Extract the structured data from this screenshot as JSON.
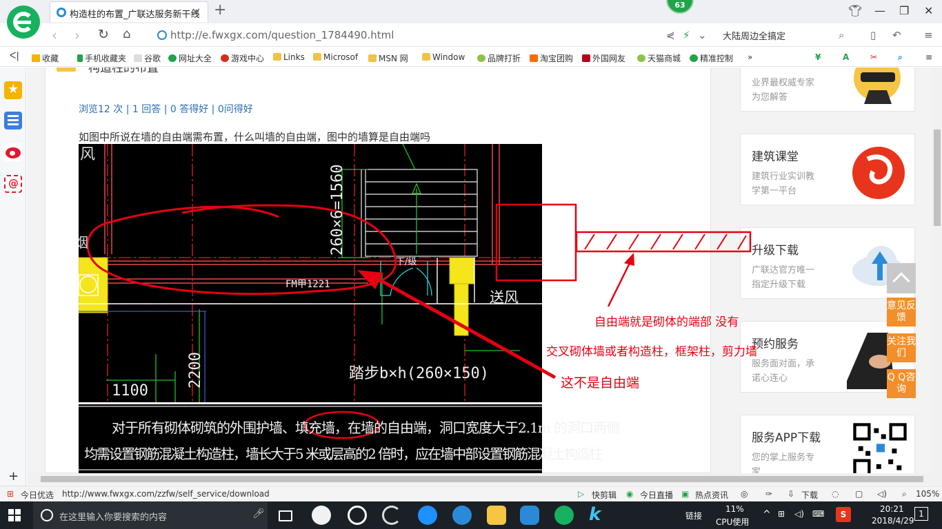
{
  "browser": {
    "tab_title": "构造柱的布置_广联达服务新干线",
    "badge_count": "63",
    "url": "http://e.fwxgx.com/question_1784490.html",
    "search_hint": "大陆周边全搞定"
  },
  "bookmarks": [
    "收藏",
    "手机收藏夹",
    "谷歌",
    "网址大全",
    "游戏中心",
    "Links",
    "Microsof",
    "MSN 网",
    "Window",
    "品牌打折",
    "淘宝团购",
    "外国网友",
    "天猫商城",
    "精准控制"
  ],
  "question": {
    "header_fragment": "构造柱的布置",
    "stats": "浏览12 次 | 1 回答 | 0 答得好 | 0问得好",
    "text": "如图中所说在墙的自由端需布置，什么叫墙的自由端，图中的墙算是自由端吗"
  },
  "cad": {
    "dim_vertical": "260×6=1560",
    "fm_label": "FM甲1221",
    "stair_label": "下/级",
    "room_label": "送风",
    "room_label2": "风",
    "room_label3": "烟",
    "dim_2200": "2200",
    "dim_1100": "1100",
    "step_label": "踏步b×h(260×150)"
  },
  "note": {
    "line1_a": "对于所有砌体砌筑的外围护墙、填充墙，在",
    "line1_b": "墙的自由端",
    "line1_c": "，洞口宽度大于2.1m 的洞口两侧",
    "line2": "均需设置钢筋混凝土构造柱，墙长大于5 米或层高的2 倍时，应在墙中部设置钢筋混凝土构造柱"
  },
  "annotations": {
    "not_free_end": "这不是自由端",
    "explain1": "自由端就是砌体的端部 没有",
    "explain2": "交叉砌体墙或者构造柱，框架柱，剪力墙"
  },
  "sidebar_cards": [
    {
      "title": "",
      "line1": "业界最权威专家",
      "line2": "为您解答"
    },
    {
      "title": "建筑课堂",
      "line1": "建筑行业实训教",
      "line2": "学第一平台"
    },
    {
      "title": "升级下载",
      "line1": "广联达官方唯一",
      "line2": "指定升级下载"
    },
    {
      "title": "预约服务",
      "line1": "服务面对面，承",
      "line2": "诺心连心"
    },
    {
      "title": "服务APP下载",
      "line1": "您的掌上服务专",
      "line2": "家"
    }
  ],
  "float_buttons": [
    "意见反馈",
    "关注我们",
    "Q Q咨询"
  ],
  "status": {
    "left": "今日优选",
    "url": "http://www.fwxgx.com/zzfw/self_service/download",
    "items": [
      "快剪辑",
      "今日直播",
      "热点资讯",
      "下载"
    ],
    "zoom": "105%"
  },
  "taskbar": {
    "search_placeholder": "在这里输入你要搜索的内容",
    "link": "链接",
    "cpu_pct": "11%",
    "cpu_label": "CPU使用",
    "time": "20:21",
    "date": "2018/4/29",
    "notif": "1"
  },
  "colors": {
    "accent": "#17b15f",
    "link": "#2b6cb2",
    "annotation": "#e60012",
    "orange": "#f38f2a"
  }
}
